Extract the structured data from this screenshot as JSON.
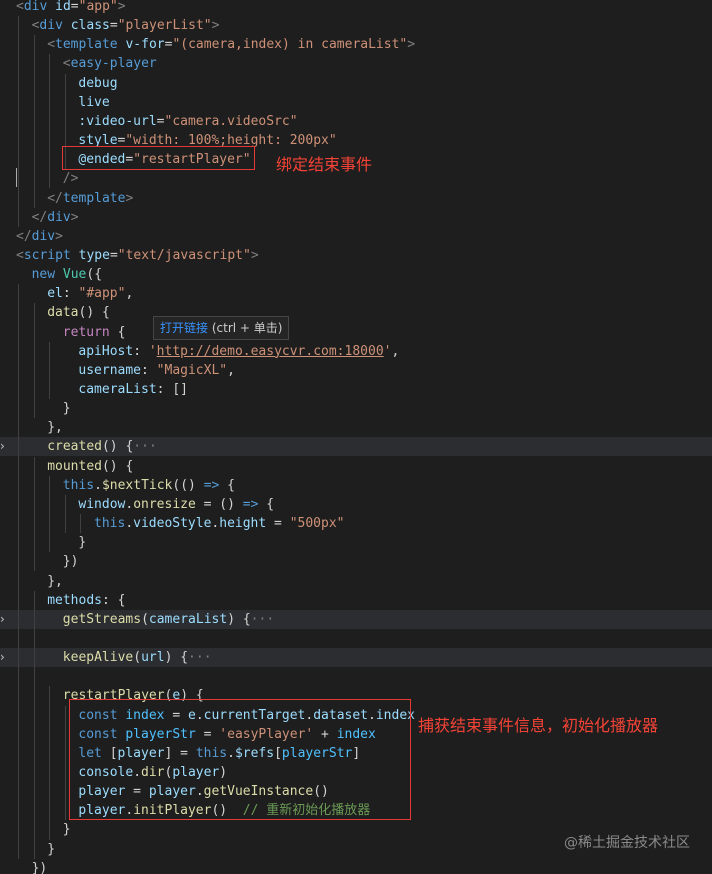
{
  "editor": {
    "lines": [
      {
        "tokens": [
          [
            "t-tag",
            "<"
          ],
          [
            "t-tagname",
            "div"
          ],
          [
            "t-attr",
            " id"
          ],
          [
            "t-punct",
            "="
          ],
          [
            "t-str",
            "\"app\""
          ],
          [
            "t-tag",
            ">"
          ]
        ]
      },
      {
        "tokens": [
          [
            "t-tag",
            "<"
          ],
          [
            "t-tagname",
            "div"
          ],
          [
            "t-attr",
            " class"
          ],
          [
            "t-punct",
            "="
          ],
          [
            "t-str",
            "\"playerList\""
          ],
          [
            "t-tag",
            ">"
          ]
        ]
      },
      {
        "tokens": [
          [
            "t-tag",
            "<"
          ],
          [
            "t-tagname",
            "template"
          ],
          [
            "t-attr",
            " v-for"
          ],
          [
            "t-punct",
            "="
          ],
          [
            "t-str",
            "\"(camera,index) in cameraList\""
          ],
          [
            "t-tag",
            ">"
          ]
        ]
      },
      {
        "tokens": [
          [
            "t-tag",
            "<"
          ],
          [
            "t-tagname",
            "easy-player"
          ]
        ]
      },
      {
        "tokens": [
          [
            "t-attr",
            "debug"
          ]
        ]
      },
      {
        "tokens": [
          [
            "t-attr",
            "live"
          ]
        ]
      },
      {
        "tokens": [
          [
            "t-attr",
            ":video-url"
          ],
          [
            "t-punct",
            "="
          ],
          [
            "t-str",
            "\"camera.videoSrc\""
          ]
        ]
      },
      {
        "tokens": [
          [
            "t-attr",
            "style"
          ],
          [
            "t-punct",
            "="
          ],
          [
            "t-str",
            "\"width: 100%;height: 200px\""
          ]
        ]
      },
      {
        "tokens": [
          [
            "t-attr",
            "@ended"
          ],
          [
            "t-punct",
            "="
          ],
          [
            "t-str",
            "\"restartPlayer\""
          ]
        ]
      },
      {
        "tokens": [
          [
            "t-tag",
            "/>"
          ]
        ]
      },
      {
        "tokens": [
          [
            "t-tag",
            "</"
          ],
          [
            "t-tagname",
            "template"
          ],
          [
            "t-tag",
            ">"
          ]
        ]
      },
      {
        "tokens": [
          [
            "t-tag",
            "</"
          ],
          [
            "t-tagname",
            "div"
          ],
          [
            "t-tag",
            ">"
          ]
        ]
      },
      {
        "tokens": [
          [
            "t-tag",
            "</"
          ],
          [
            "t-tagname",
            "div"
          ],
          [
            "t-tag",
            ">"
          ]
        ]
      },
      {
        "tokens": [
          [
            "t-tag",
            "<"
          ],
          [
            "t-tagname",
            "script"
          ],
          [
            "t-attr",
            " type"
          ],
          [
            "t-punct",
            "="
          ],
          [
            "t-str",
            "\"text/javascript\""
          ],
          [
            "t-tag",
            ">"
          ]
        ]
      },
      {
        "tokens": [
          [
            "t-kw",
            "new "
          ],
          [
            "t-cls",
            "Vue"
          ],
          [
            "t-punct",
            "({"
          ]
        ]
      },
      {
        "tokens": [
          [
            "t-var",
            "el"
          ],
          [
            "t-punct",
            ": "
          ],
          [
            "t-str",
            "\"#app\""
          ],
          [
            "t-punct",
            ","
          ]
        ]
      },
      {
        "tokens": [
          [
            "t-fn",
            "data"
          ],
          [
            "t-punct",
            "() {"
          ]
        ]
      },
      {
        "tokens": [
          [
            "t-ctrl",
            "return "
          ],
          [
            "t-punct",
            "{"
          ]
        ]
      },
      {
        "tokens": [
          [
            "t-var",
            "apiHost"
          ],
          [
            "t-punct",
            ": "
          ],
          [
            "t-str",
            "'"
          ],
          [
            "t-link",
            "http://demo.easycvr.com:18000"
          ],
          [
            "t-str",
            "'"
          ],
          [
            "t-punct",
            ","
          ]
        ]
      },
      {
        "tokens": [
          [
            "t-var",
            "username"
          ],
          [
            "t-punct",
            ": "
          ],
          [
            "t-str",
            "\"MagicXL\""
          ],
          [
            "t-punct",
            ","
          ]
        ]
      },
      {
        "tokens": [
          [
            "t-var",
            "cameraList"
          ],
          [
            "t-punct",
            ": []"
          ]
        ]
      },
      {
        "tokens": [
          [
            "t-punct",
            "}"
          ]
        ]
      },
      {
        "tokens": [
          [
            "t-punct",
            "},"
          ]
        ]
      },
      {
        "tokens": [
          [
            "t-fn",
            "created"
          ],
          [
            "t-punct",
            "() {"
          ],
          [
            "t-fold",
            "···"
          ]
        ]
      },
      {
        "tokens": [
          [
            "t-fn",
            "mounted"
          ],
          [
            "t-punct",
            "() {"
          ]
        ]
      },
      {
        "tokens": [
          [
            "t-kw",
            "this"
          ],
          [
            "t-punct",
            "."
          ],
          [
            "t-fn",
            "$nextTick"
          ],
          [
            "t-punct",
            "(() "
          ],
          [
            "t-kw",
            "=>"
          ],
          [
            "t-punct",
            " {"
          ]
        ]
      },
      {
        "tokens": [
          [
            "t-var",
            "window"
          ],
          [
            "t-punct",
            "."
          ],
          [
            "t-fn",
            "onresize"
          ],
          [
            "t-punct",
            " = () "
          ],
          [
            "t-kw",
            "=>"
          ],
          [
            "t-punct",
            " {"
          ]
        ]
      },
      {
        "tokens": [
          [
            "t-kw",
            "this"
          ],
          [
            "t-punct",
            "."
          ],
          [
            "t-var",
            "videoStyle"
          ],
          [
            "t-punct",
            "."
          ],
          [
            "t-var",
            "height"
          ],
          [
            "t-punct",
            " = "
          ],
          [
            "t-str",
            "\"500px\""
          ]
        ]
      },
      {
        "tokens": [
          [
            "t-punct",
            "}"
          ]
        ]
      },
      {
        "tokens": [
          [
            "t-punct",
            "})"
          ]
        ]
      },
      {
        "tokens": [
          [
            "t-punct",
            "},"
          ]
        ]
      },
      {
        "tokens": [
          [
            "t-var",
            "methods"
          ],
          [
            "t-punct",
            ": {"
          ]
        ]
      },
      {
        "tokens": [
          [
            "t-fn",
            "getStreams"
          ],
          [
            "t-punct",
            "("
          ],
          [
            "t-var",
            "cameraList"
          ],
          [
            "t-punct",
            ") {"
          ],
          [
            "t-fold",
            "···"
          ]
        ]
      },
      {
        "tokens": []
      },
      {
        "tokens": [
          [
            "t-fn",
            "keepAlive"
          ],
          [
            "t-punct",
            "("
          ],
          [
            "t-var",
            "url"
          ],
          [
            "t-punct",
            ") {"
          ],
          [
            "t-fold",
            "···"
          ]
        ]
      },
      {
        "tokens": []
      },
      {
        "tokens": [
          [
            "t-fn",
            "restartPlayer"
          ],
          [
            "t-punct",
            "("
          ],
          [
            "t-var",
            "e"
          ],
          [
            "t-punct",
            ") {"
          ]
        ]
      },
      {
        "tokens": [
          [
            "t-kw",
            "const "
          ],
          [
            "t-const",
            "index"
          ],
          [
            "t-punct",
            " = "
          ],
          [
            "t-var",
            "e"
          ],
          [
            "t-punct",
            "."
          ],
          [
            "t-var",
            "currentTarget"
          ],
          [
            "t-punct",
            "."
          ],
          [
            "t-var",
            "dataset"
          ],
          [
            "t-punct",
            "."
          ],
          [
            "t-var",
            "index"
          ]
        ]
      },
      {
        "tokens": [
          [
            "t-kw",
            "const "
          ],
          [
            "t-const",
            "playerStr"
          ],
          [
            "t-punct",
            " = "
          ],
          [
            "t-str",
            "'easyPlayer'"
          ],
          [
            "t-punct",
            " + "
          ],
          [
            "t-const",
            "index"
          ]
        ]
      },
      {
        "tokens": [
          [
            "t-kw",
            "let "
          ],
          [
            "t-punct",
            "["
          ],
          [
            "t-var",
            "player"
          ],
          [
            "t-punct",
            "] = "
          ],
          [
            "t-kw",
            "this"
          ],
          [
            "t-punct",
            "."
          ],
          [
            "t-var",
            "$refs"
          ],
          [
            "t-punct",
            "["
          ],
          [
            "t-const",
            "playerStr"
          ],
          [
            "t-punct",
            "]"
          ]
        ]
      },
      {
        "tokens": [
          [
            "t-var",
            "console"
          ],
          [
            "t-punct",
            "."
          ],
          [
            "t-fn",
            "dir"
          ],
          [
            "t-punct",
            "("
          ],
          [
            "t-var",
            "player"
          ],
          [
            "t-punct",
            ")"
          ]
        ]
      },
      {
        "tokens": [
          [
            "t-var",
            "player"
          ],
          [
            "t-punct",
            " = "
          ],
          [
            "t-var",
            "player"
          ],
          [
            "t-punct",
            "."
          ],
          [
            "t-fn",
            "getVueInstance"
          ],
          [
            "t-punct",
            "()"
          ]
        ]
      },
      {
        "tokens": [
          [
            "t-var",
            "player"
          ],
          [
            "t-punct",
            "."
          ],
          [
            "t-fn",
            "initPlayer"
          ],
          [
            "t-punct",
            "()  "
          ],
          [
            "t-comment",
            "// 重新初始化播放器"
          ]
        ]
      },
      {
        "tokens": [
          [
            "t-punct",
            "}"
          ]
        ]
      },
      {
        "tokens": [
          [
            "t-punct",
            "}"
          ]
        ]
      },
      {
        "tokens": [
          [
            "t-punct",
            "})"
          ]
        ]
      }
    ]
  },
  "annotations": {
    "bind_end_event": "绑定结束事件",
    "capture_end_event": "捕获结束事件信息，初始化播放器"
  },
  "tooltip": {
    "link_label": "打开链接",
    "hint": " (ctrl + 单击)"
  },
  "watermark": "@稀土掘金技术社区"
}
